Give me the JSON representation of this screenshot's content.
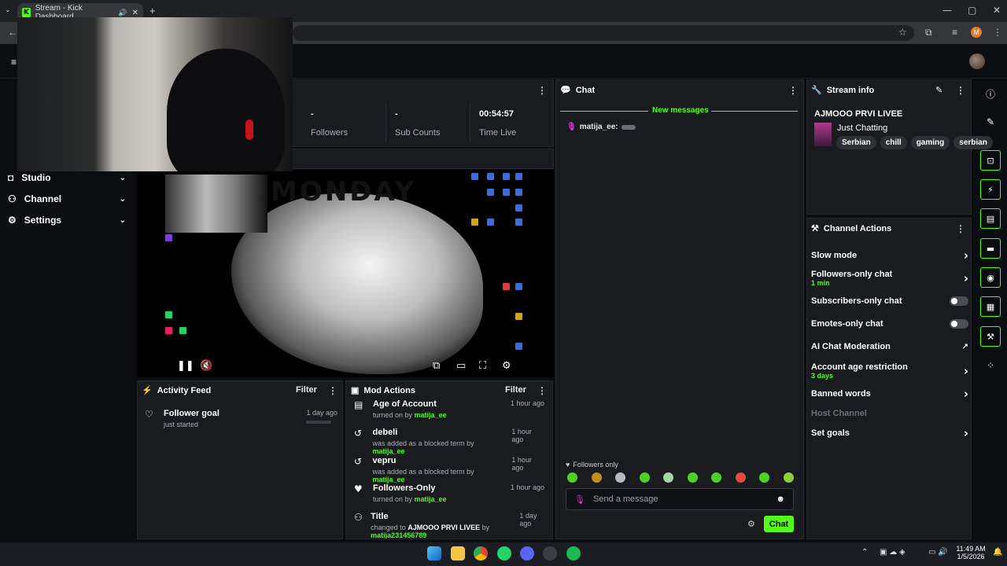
{
  "browser": {
    "tab_title": "Stream - Kick Dashboard",
    "new_tab": "+",
    "profile_initial": "M"
  },
  "sidebar": {
    "items": [
      {
        "label": "Studio",
        "icon": "studio-icon"
      },
      {
        "label": "Channel",
        "icon": "channel-icon"
      },
      {
        "label": "Settings",
        "icon": "gear-icon"
      }
    ]
  },
  "stats": [
    {
      "value": "-",
      "label": "Followers"
    },
    {
      "value": "-",
      "label": "Sub Counts"
    },
    {
      "value": "00:54:57",
      "label": "Time Live"
    }
  ],
  "video": {
    "overlay_text": "MONDAY"
  },
  "chat": {
    "title": "Chat",
    "new_messages": "New messages",
    "messages": [
      {
        "user": "matija_ee:",
        "text": ""
      }
    ],
    "followers_only": "Followers only",
    "input_placeholder": "Send a message",
    "send_label": "Chat"
  },
  "stream_info": {
    "title": "Stream info",
    "stream_title": "AJMOOO PRVI LIVEE",
    "category": "Just Chatting",
    "tags": [
      "Serbian",
      "chill",
      "gaming",
      "serbian"
    ]
  },
  "channel_actions": {
    "title": "Channel Actions",
    "items": [
      {
        "label": "Slow mode",
        "sub": "",
        "control": "chevron"
      },
      {
        "label": "Followers-only chat",
        "sub": "1 min",
        "control": "chevron"
      },
      {
        "label": "Subscribers-only chat",
        "sub": "",
        "control": "toggle"
      },
      {
        "label": "Emotes-only chat",
        "sub": "",
        "control": "toggle"
      },
      {
        "label": "AI Chat Moderation",
        "sub": "",
        "control": "external"
      },
      {
        "label": "Account age restriction",
        "sub": "3 days",
        "control": "chevron"
      },
      {
        "label": "Banned words",
        "sub": "",
        "control": "chevron"
      },
      {
        "label": "Host Channel",
        "sub": "",
        "control": "disabled"
      },
      {
        "label": "Set goals",
        "sub": "",
        "control": "chevron"
      }
    ]
  },
  "activity_feed": {
    "title": "Activity Feed",
    "filter": "Filter",
    "items": [
      {
        "title": "Follower goal",
        "desc": "just started",
        "time": "1 day ago"
      }
    ]
  },
  "mod_actions": {
    "title": "Mod Actions",
    "filter": "Filter",
    "items": [
      {
        "title": "Age of Account",
        "desc_prefix": "turned on by ",
        "user": "matija_ee",
        "time": "1 hour ago"
      },
      {
        "title": "debeli",
        "desc_prefix": "was added as a blocked term by ",
        "user": "matija_ee",
        "time": "1 hour ago"
      },
      {
        "title": "vepru",
        "desc_prefix": "was added as a blocked term by ",
        "user": "matija_ee",
        "time": "1 hour ago"
      },
      {
        "title": "Followers-Only",
        "desc_prefix": "turned on by ",
        "user": "matija_ee",
        "time": "1 hour ago"
      },
      {
        "title": "Title",
        "desc_prefix": "changed to ",
        "value": "AJMOOO PRVI LIVEE",
        "desc_mid": " by ",
        "user": "matija231456789",
        "time": "1 day ago"
      }
    ]
  },
  "taskbar": {
    "time": "11:49 AM",
    "date": "1/5/2026"
  }
}
